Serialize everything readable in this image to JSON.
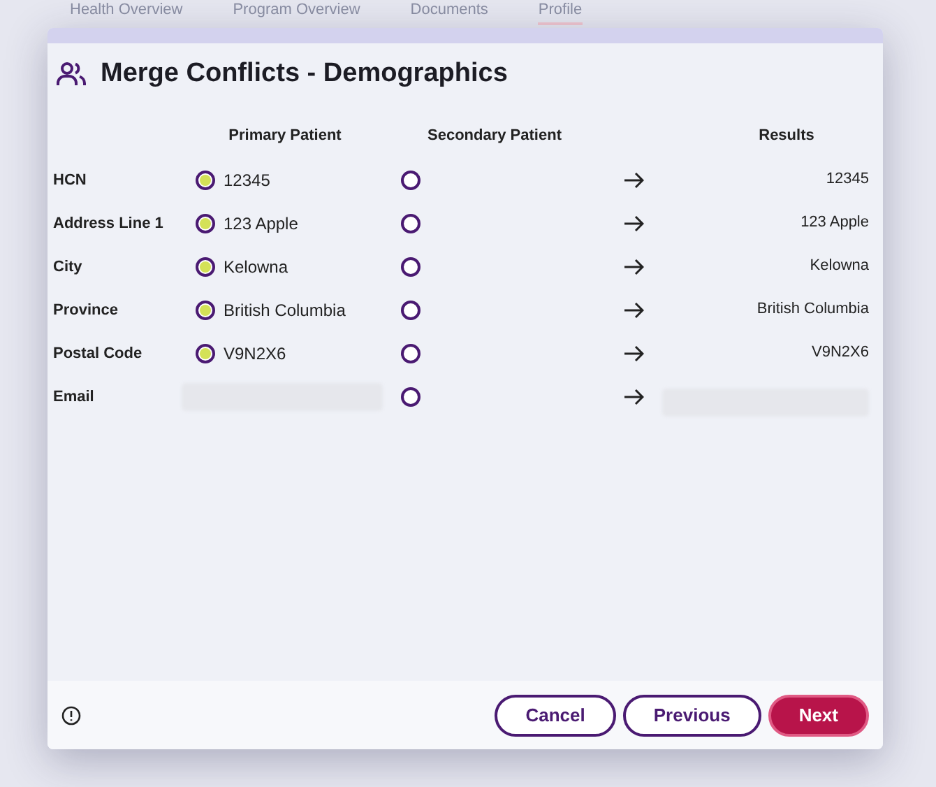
{
  "background_tabs": [
    {
      "label": "Health Overview",
      "selected": false
    },
    {
      "label": "Program Overview",
      "selected": false
    },
    {
      "label": "Documents",
      "selected": false
    },
    {
      "label": "Profile",
      "selected": true
    }
  ],
  "dialog": {
    "title": "Merge Conflicts - Demographics",
    "columns": [
      "Primary Patient",
      "Secondary Patient",
      "Results"
    ],
    "rows": [
      {
        "label": "HCN",
        "primary": {
          "kind": "value",
          "value": "12345",
          "selected": true
        },
        "secondary": {
          "selected": false
        },
        "result": {
          "kind": "value",
          "value": "12345"
        }
      },
      {
        "label": "Address Line 1",
        "primary": {
          "kind": "value",
          "value": "123 Apple",
          "selected": true
        },
        "secondary": {
          "selected": false
        },
        "result": {
          "kind": "value",
          "value": "123 Apple"
        }
      },
      {
        "label": "City",
        "primary": {
          "kind": "value",
          "value": "Kelowna",
          "selected": true
        },
        "secondary": {
          "selected": false
        },
        "result": {
          "kind": "value",
          "value": "Kelowna"
        }
      },
      {
        "label": "Province",
        "primary": {
          "kind": "value",
          "value": "British Columbia",
          "selected": true
        },
        "secondary": {
          "selected": false
        },
        "result": {
          "kind": "value",
          "value": "British Columbia"
        }
      },
      {
        "label": "Postal Code",
        "primary": {
          "kind": "value",
          "value": "V9N2X6",
          "selected": true
        },
        "secondary": {
          "selected": false
        },
        "result": {
          "kind": "value",
          "value": "V9N2X6"
        }
      },
      {
        "label": "Email",
        "primary": {
          "kind": "redacted"
        },
        "secondary": {
          "selected": false
        },
        "result": {
          "kind": "redacted"
        }
      }
    ],
    "buttons": [
      {
        "label": "Cancel",
        "kind": "secondary"
      },
      {
        "label": "Previous",
        "kind": "secondary"
      },
      {
        "label": "Next",
        "kind": "primary"
      }
    ]
  }
}
